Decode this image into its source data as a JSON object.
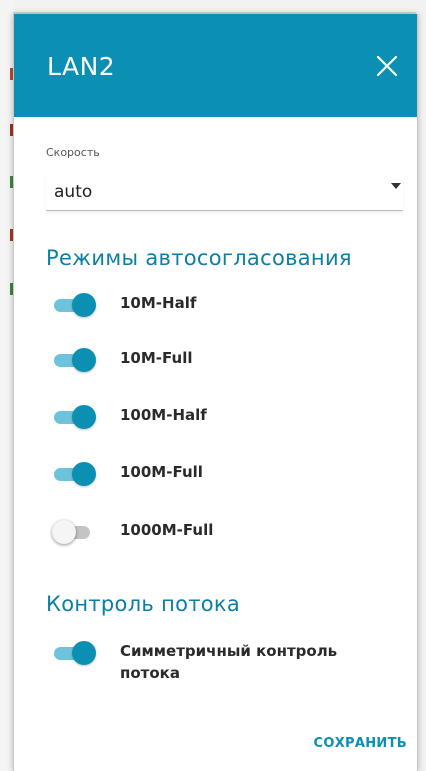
{
  "dialog": {
    "title": "LAN2",
    "close_icon": "close-icon"
  },
  "speed": {
    "label": "Скорость",
    "value": "auto"
  },
  "autoneg": {
    "title": "Режимы автосогласования",
    "modes": [
      {
        "label": "10M-Half",
        "enabled": true
      },
      {
        "label": "10M-Full",
        "enabled": true
      },
      {
        "label": "100M-Half",
        "enabled": true
      },
      {
        "label": "100M-Full",
        "enabled": true
      },
      {
        "label": "1000M-Full",
        "enabled": false
      }
    ]
  },
  "flow_control": {
    "title": "Контроль потока",
    "symmetric_label": "Симметричный контроль потока",
    "enabled": true
  },
  "actions": {
    "save_label": "СОХРАНИТЬ"
  },
  "colors": {
    "accent": "#0b8fb3",
    "accent_light": "#6ec3dc",
    "section_title": "#0b7fa5"
  }
}
